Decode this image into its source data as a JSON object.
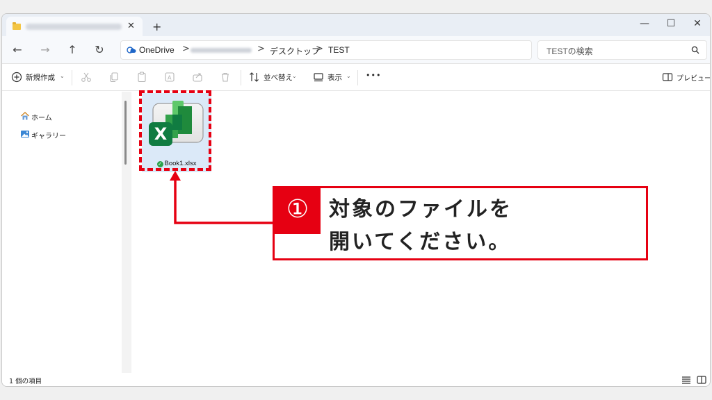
{
  "window": {
    "tab_close": "✕",
    "new_tab": "+",
    "minimize": "—",
    "maximize": "☐",
    "close": "✕"
  },
  "nav": {
    "back": "←",
    "forward": "→",
    "up": "↑",
    "refresh": "↻"
  },
  "breadcrumb": {
    "items": [
      "OneDrive",
      "デスクトップ",
      "TEST"
    ],
    "separator": ">"
  },
  "search": {
    "placeholder": "TESTの検索"
  },
  "toolbar": {
    "new_label": "新規作成",
    "sort_label": "並べ替え",
    "view_label": "表示",
    "more_label": "•••",
    "preview_label": "プレビュー"
  },
  "sidebar": {
    "items": [
      {
        "label": "ホーム",
        "icon": "home-icon"
      },
      {
        "label": "ギャラリー",
        "icon": "gallery-icon"
      }
    ]
  },
  "files": [
    {
      "name": "Book1.xlsx",
      "icon": "excel-icon",
      "status": "synced",
      "status_icon": "✓"
    }
  ],
  "annotation": {
    "number": "①",
    "line1": "対象のファイルを",
    "line2": "開いてください。",
    "color": "#e60012"
  },
  "status": {
    "item_count": "1 個の項目"
  }
}
